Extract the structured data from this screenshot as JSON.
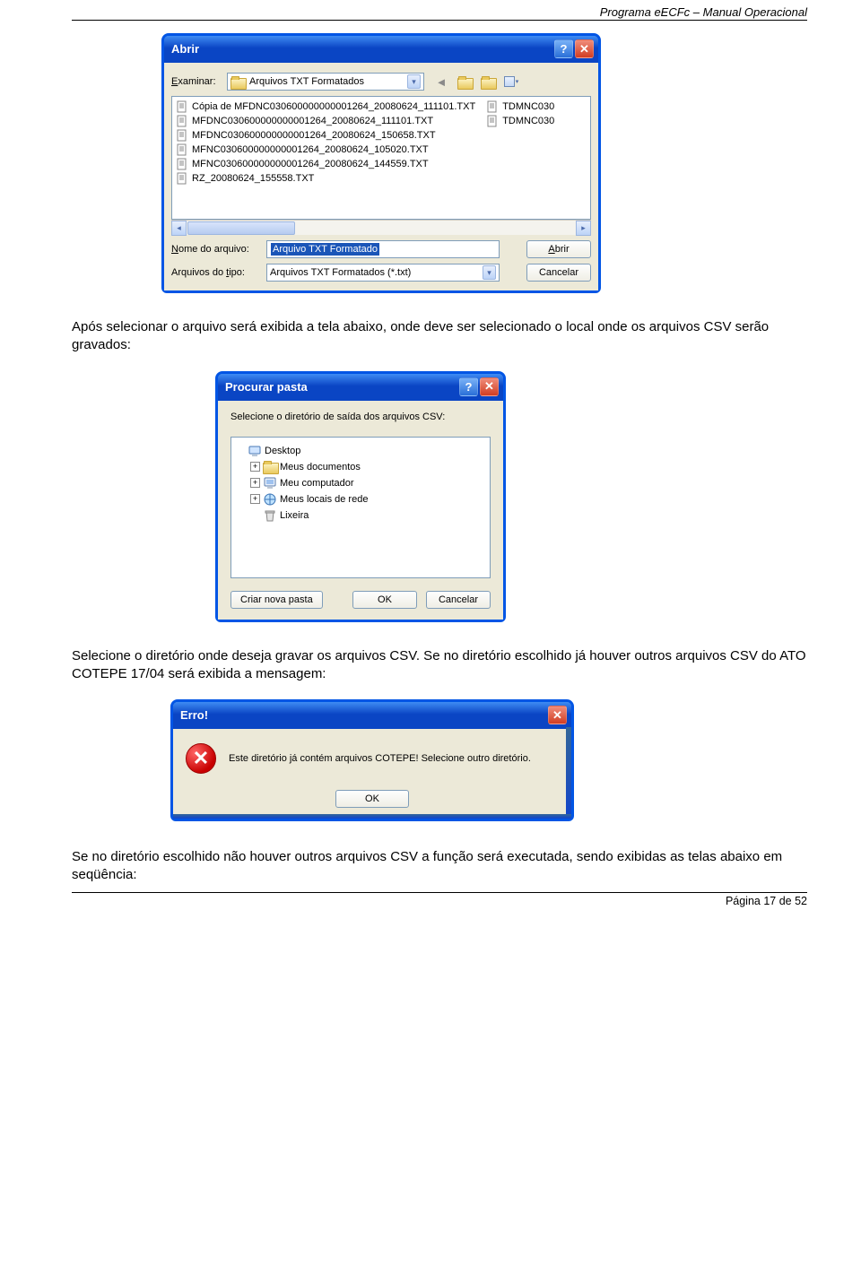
{
  "header": "Programa eECFc – Manual Operacional",
  "open_dialog": {
    "title": "Abrir",
    "examine_label": "Examinar:",
    "folder_name": "Arquivos TXT Formatados",
    "files_col1": [
      "Cópia de MFDNC030600000000001264_20080624_111101.TXT",
      "MFDNC030600000000001264_20080624_111101.TXT",
      "MFDNC030600000000001264_20080624_150658.TXT",
      "MFNC030600000000001264_20080624_105020.TXT",
      "MFNC030600000000001264_20080624_144559.TXT",
      "RZ_20080624_155558.TXT"
    ],
    "files_col2": [
      "TDMNC030",
      "TDMNC030"
    ],
    "filename_label": "Nome do arquivo:",
    "filename_value": "Arquivo TXT Formatado",
    "filetype_label": "Arquivos do tipo:",
    "filetype_value": "Arquivos TXT Formatados (*.txt)",
    "open_button": "Abrir",
    "cancel_button": "Cancelar"
  },
  "para1": "Após selecionar o arquivo será exibida a tela abaixo, onde deve ser selecionado o local onde os arquivos CSV serão gravados:",
  "browse_dialog": {
    "title": "Procurar pasta",
    "instruction": "Selecione o diretório de saída dos arquivos CSV:",
    "tree": [
      {
        "expander": "",
        "icon": "desktop",
        "label": "Desktop",
        "indent": 0
      },
      {
        "expander": "+",
        "icon": "folder",
        "label": "Meus documentos",
        "indent": 1
      },
      {
        "expander": "+",
        "icon": "computer",
        "label": "Meu computador",
        "indent": 1
      },
      {
        "expander": "+",
        "icon": "network",
        "label": "Meus locais de rede",
        "indent": 1
      },
      {
        "expander": "",
        "icon": "trash",
        "label": "Lixeira",
        "indent": 1
      }
    ],
    "new_folder": "Criar nova pasta",
    "ok": "OK",
    "cancel": "Cancelar"
  },
  "para2": "Selecione o diretório onde deseja gravar os arquivos CSV. Se no diretório escolhido já houver outros arquivos CSV do ATO COTEPE 17/04 será exibida a mensagem:",
  "error_dialog": {
    "title": "Erro!",
    "message": "Este diretório já contém arquivos COTEPE! Selecione outro diretório.",
    "ok": "OK"
  },
  "para3": "Se no diretório escolhido não houver outros arquivos CSV a função será executada, sendo exibidas as telas abaixo em seqüência:",
  "footer": "Página 17 de 52"
}
